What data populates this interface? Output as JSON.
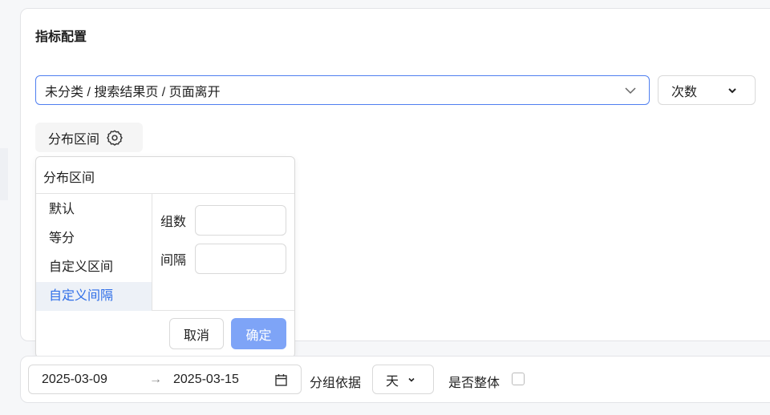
{
  "metric_config": {
    "title": "指标配置",
    "event_select": "未分类 / 搜索结果页 / 页面离开",
    "measure_select": "次数",
    "distribution_button": "分布区间"
  },
  "distribution_popover": {
    "title": "分布区间",
    "options": [
      "默认",
      "等分",
      "自定义区间",
      "自定义间隔"
    ],
    "selected": "自定义间隔",
    "fields": [
      {
        "label": "组数",
        "value": ""
      },
      {
        "label": "间隔",
        "value": ""
      }
    ],
    "cancel": "取消",
    "confirm": "确定"
  },
  "filters": {
    "start_date": "2025-03-09",
    "end_date": "2025-03-15",
    "group_by_label": "分组依据",
    "group_by_value": "天",
    "overall_label": "是否整体",
    "overall_checked": false
  },
  "colors": {
    "accent": "#4f7ff0",
    "confirm_bg": "#7ea4f7",
    "selected_text": "#2f6ee8"
  }
}
